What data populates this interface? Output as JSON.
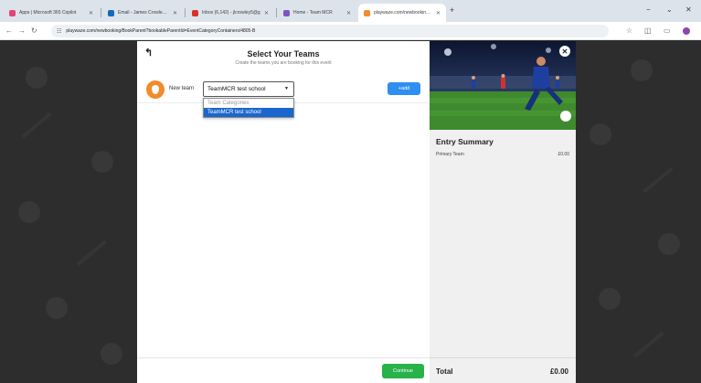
{
  "browser": {
    "tabs": [
      {
        "title": "Apps | Microsoft 365 Copilot",
        "color": "#e0457b",
        "active": false
      },
      {
        "title": "Email - James Crowley - Outlo",
        "color": "#0f6cbd",
        "active": false
      },
      {
        "title": "Inbox (6,142) - jlcrowley5@g",
        "color": "#d93025",
        "active": false
      },
      {
        "title": "Home - Team MCR",
        "color": "#7a56c2",
        "active": false
      },
      {
        "title": "playwaze.com/newbooking/Bo",
        "color": "#f28b2c",
        "active": true
      }
    ],
    "new_tab": "+",
    "minimize": "−",
    "restore": "⌄",
    "close": "✕",
    "url": "playwaze.com/newbooking/BookParent?bookableParentId=EventCategoryContainers/4805-B"
  },
  "page": {
    "title": "Select Your Teams",
    "subtitle": "Create the teams you are booking for this event",
    "team_label": "New team",
    "selected_team": "TeamMCR test school",
    "add_label": "+add",
    "dropdown_options": [
      "Team Categories",
      "TeamMCR test school"
    ],
    "continue_label": "Continue"
  },
  "summary": {
    "title": "Entry Summary",
    "row_label": "Primary Team",
    "row_amount": "£0.00",
    "total_label": "Total",
    "total_amount": "£0.00"
  },
  "colors": {
    "accent_blue": "#2f8ff0",
    "continue_green": "#27b24a",
    "team_icon_orange": "#f28b2c",
    "dropdown_highlight": "#1a66cc"
  }
}
